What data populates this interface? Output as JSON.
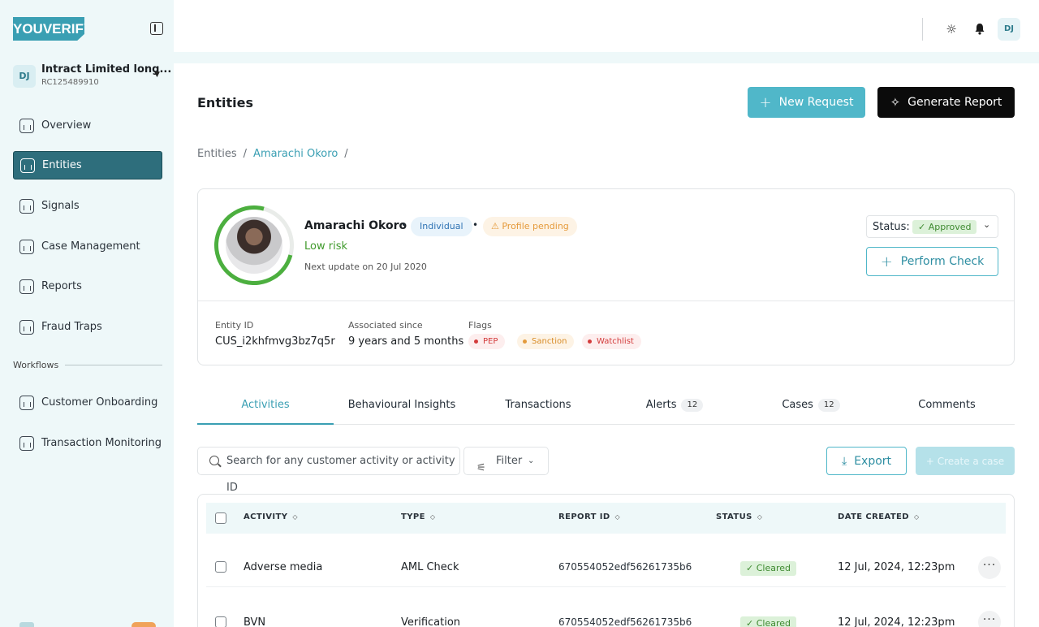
{
  "brand": {
    "logo_text": "YOUVERIFY",
    "accent": "#3a9fb3"
  },
  "org": {
    "avatar": "DJ",
    "name": "Intract Limited long...",
    "id": "RC125489910"
  },
  "nav": {
    "items": [
      {
        "label": "Overview",
        "icon": "chart-icon"
      },
      {
        "label": "Entities",
        "icon": "chart-icon",
        "active": true
      },
      {
        "label": "Signals",
        "icon": "trend-icon"
      },
      {
        "label": "Case Management",
        "icon": "folder-icon"
      },
      {
        "label": "Reports",
        "icon": "document-icon"
      },
      {
        "label": "Fraud Traps",
        "icon": "database-icon"
      }
    ],
    "section": "Workflows",
    "workflow_items": [
      {
        "label": "Customer Onboarding",
        "icon": "scan-icon"
      },
      {
        "label": "Transaction Monitoring",
        "icon": "card-icon"
      }
    ]
  },
  "topbar": {
    "avatar": "DJ",
    "sun_icon": "☼",
    "bell_icon": "🔔"
  },
  "header": {
    "title": "Entities",
    "new_request": "New Request",
    "generate_report": "Generate Report",
    "plus": "+",
    "spark": "✧"
  },
  "breadcrumb": {
    "root": "Entities",
    "sep": "/",
    "current": "Amarachi Okoro",
    "trail": "/"
  },
  "profile": {
    "name": "Amarachi Okoro",
    "bullet": "•",
    "type": "Individual",
    "pending": "⚠ Profile pending",
    "risk": "Low risk",
    "next_update": "Next update on 20 Jul 2020",
    "status_label": "Status:",
    "status_value": "✓ Approved",
    "status_caret": "⌄",
    "perform_check": "Perform Check",
    "entity_id_label": "Entity ID",
    "entity_id": "CUS_i2khfmvg3bz7q5r",
    "associated_label": "Associated since",
    "associated_value": "9 years and 5 months",
    "flags_label": "Flags",
    "flags": [
      "PEP",
      "Sanction",
      "Watchlist"
    ]
  },
  "tabs": [
    {
      "label": "Activities",
      "active": true
    },
    {
      "label": "Behavioural Insights"
    },
    {
      "label": "Transactions"
    },
    {
      "label": "Alerts",
      "count": "12"
    },
    {
      "label": "Cases",
      "count": "12"
    },
    {
      "label": "Comments"
    }
  ],
  "toolbar": {
    "search_placeholder": "Search for any customer activity or activity ID",
    "filter": "Filter",
    "filter_caret": "⌄",
    "filter_icon": "⚟",
    "export": "Export",
    "export_icon": "⤓",
    "create_case": "+ Create a case"
  },
  "table": {
    "columns": [
      "ACTIVITY",
      "TYPE",
      "REPORT ID",
      "STATUS",
      "DATE CREATED"
    ],
    "sort_icon": "◇",
    "more_icon": "···",
    "rows": [
      {
        "activity": "Adverse media",
        "type": "AML Check",
        "report_id": "670554052edf56261735b6",
        "status": "✓ Cleared",
        "date": "12 Jul, 2024, 12:23pm"
      },
      {
        "activity": "BVN",
        "type": "Verification",
        "report_id": "670554052edf56261735b6",
        "status": "✓ Cleared",
        "date": "12 Jul, 2024, 12:23pm"
      }
    ]
  }
}
